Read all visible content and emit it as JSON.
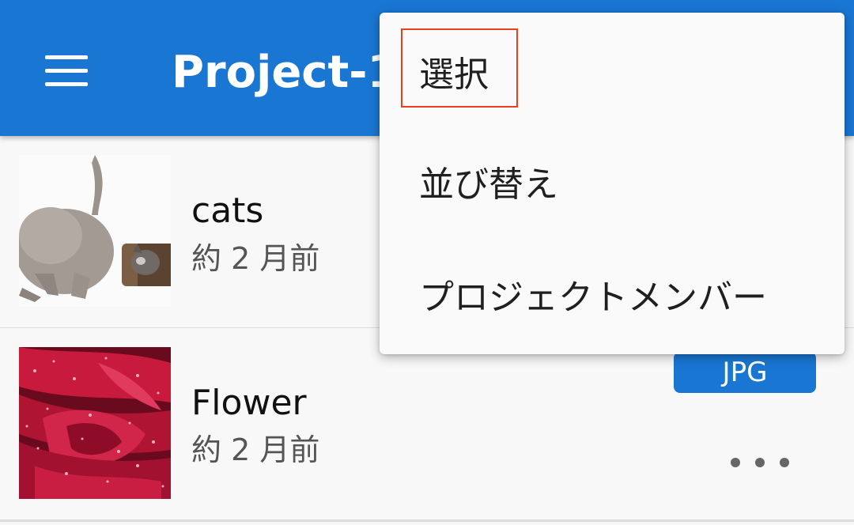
{
  "appbar": {
    "title": "Project-1",
    "color": "#1976d2",
    "menu_icon": "hamburger-menu-icon"
  },
  "list": {
    "items": [
      {
        "name": "cats",
        "date": "約 2 月前",
        "thumbnail": "kitten-photo"
      },
      {
        "name": "Flower",
        "date": "約 2 月前",
        "thumbnail": "red-rose-photo",
        "badge": "JPG",
        "more_icon": "more-horizontal-icon"
      }
    ]
  },
  "popup_menu": {
    "items": [
      {
        "label": "選択",
        "highlighted": true
      },
      {
        "label": "並び替え"
      },
      {
        "label": "プロジェクトメンバー"
      }
    ],
    "highlight_color": "#e8401c"
  }
}
